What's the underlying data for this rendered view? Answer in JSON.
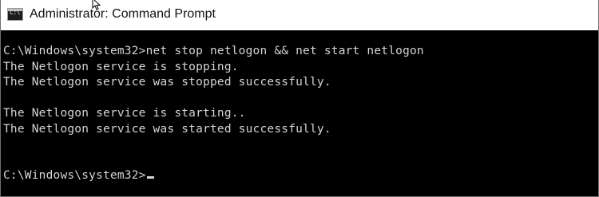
{
  "window": {
    "title": "Administrator: Command Prompt",
    "icon": "cmd-console-icon",
    "icon_label": "C:\\"
  },
  "console": {
    "lines": [
      "C:\\Windows\\system32>net stop netlogon && net start netlogon",
      "The Netlogon service is stopping.",
      "The Netlogon service was stopped successfully.",
      "",
      "The Netlogon service is starting..",
      "The Netlogon service was started successfully.",
      "",
      "",
      "C:\\Windows\\system32>"
    ]
  },
  "colors": {
    "console_background": "#000000",
    "console_text": "#d4d4d4",
    "titlebar_background": "#ffffff"
  }
}
